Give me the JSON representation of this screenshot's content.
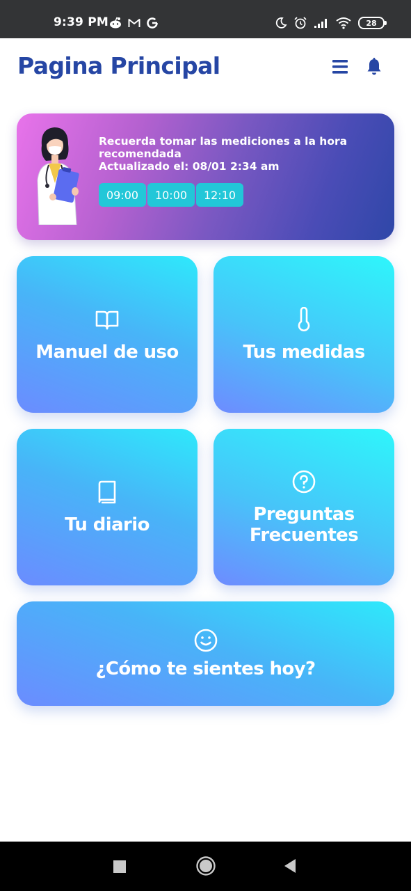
{
  "status_bar": {
    "time": "9:39 PM",
    "battery": "28",
    "left_icons": [
      "reddit-icon",
      "gmail-icon",
      "google-icon"
    ],
    "right_icons": [
      "moon-icon",
      "alarm-icon",
      "signal-icon",
      "wifi-icon",
      "battery-icon"
    ]
  },
  "header": {
    "title": "Pagina Principal",
    "menu_icon": "hamburger-menu-icon",
    "notification_icon": "bell-icon"
  },
  "reminder": {
    "line1": "Recuerda tomar las mediciones a la hora recomendada",
    "line2": "Actualizado el: 08/01 2:34 am",
    "times": [
      "09:00",
      "10:00",
      "12:10"
    ],
    "illustration": "doctor-illustration"
  },
  "tiles": {
    "manual": {
      "label": "Manuel de uso",
      "icon": "book-open-icon"
    },
    "medidas": {
      "label": "Tus medidas",
      "icon": "thermometer-icon"
    },
    "diario": {
      "label": "Tu diario",
      "icon": "book-icon"
    },
    "preguntas": {
      "label": "Preguntas Frecuentes",
      "icon": "help-circle-icon"
    },
    "sientes": {
      "label": "¿Cómo te sientes hoy?",
      "icon": "smile-icon"
    }
  },
  "colors": {
    "title": "#2646a4",
    "chip": "#22c7d8",
    "banner_start": "#e873ea",
    "banner_end": "#2f47a8",
    "tile_cyan": "#2ee9fb",
    "tile_blue": "#6b8cff"
  },
  "nav_bar": {
    "buttons": [
      "recents-square-icon",
      "home-circle-icon",
      "back-triangle-icon"
    ]
  }
}
